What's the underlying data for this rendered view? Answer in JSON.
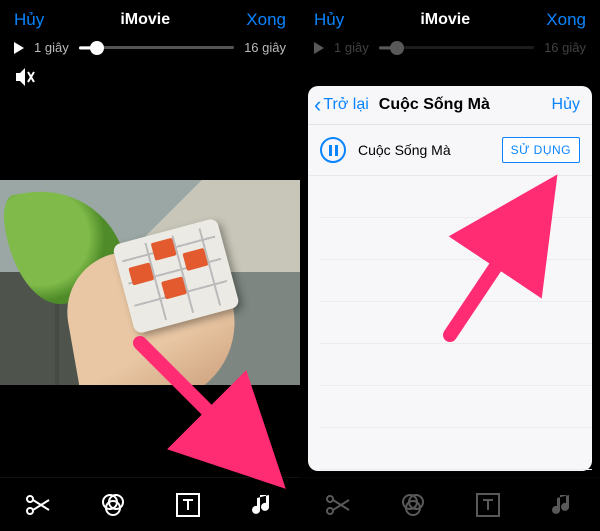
{
  "left": {
    "topbar": {
      "cancel": "Hủy",
      "title": "iMovie",
      "done": "Xong"
    },
    "time": {
      "current": "1 giây",
      "total": "16 giây",
      "progress_pct": 12
    }
  },
  "right": {
    "topbar": {
      "cancel": "Hủy",
      "title": "iMovie",
      "done": "Xong"
    },
    "time": {
      "current": "1 giây",
      "total": "16 giây",
      "progress_pct": 12
    },
    "sheet": {
      "back_label": "Trở lại",
      "title": "Cuộc Sống Mà",
      "cancel": "Hủy",
      "song_name": "Cuộc Sống Mà",
      "use_label": "SỬ DỤNG"
    }
  },
  "icons": {
    "scissors": "scissors-icon",
    "filters": "filters-icon",
    "text": "text-icon",
    "music": "music-icon",
    "mute": "mute-icon",
    "play": "play-icon",
    "pause": "pause-icon",
    "chevron_left": "chevron-left-icon"
  },
  "colors": {
    "accent": "#0a84ff",
    "arrow": "#ff2b73"
  }
}
